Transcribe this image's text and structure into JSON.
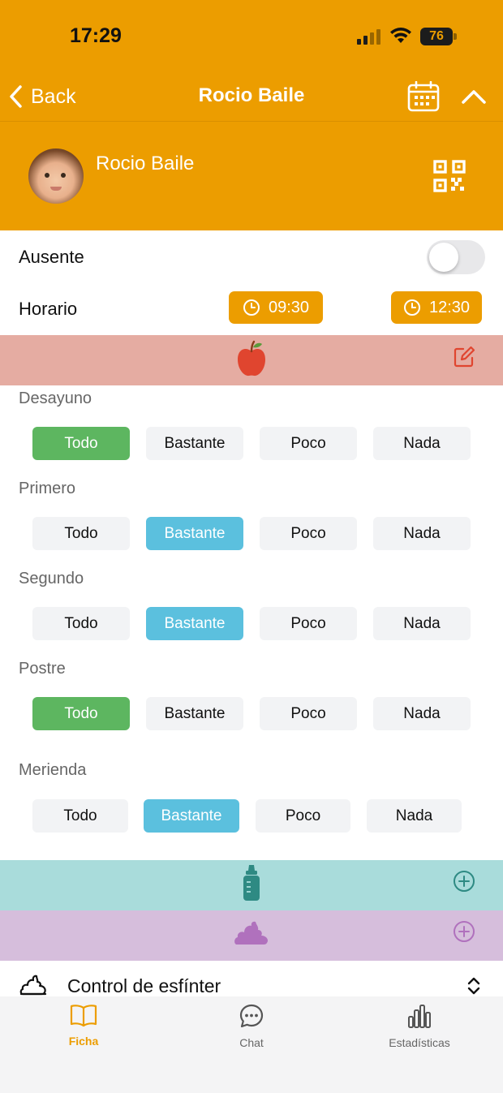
{
  "status_bar": {
    "time": "17:29",
    "battery": "76"
  },
  "nav": {
    "back_label": "Back",
    "title": "Rocio Baile"
  },
  "profile": {
    "name": "Rocio Baile"
  },
  "absence": {
    "label": "Ausente",
    "enabled": false
  },
  "schedule": {
    "label": "Horario",
    "start": "09:30",
    "end": "12:30"
  },
  "colors": {
    "accent": "#ec9d00",
    "selected_all": "#5db660",
    "selected_enough": "#5bc0de",
    "food_band": "#e5aca2",
    "bottle_band": "#a9dcdb",
    "diaper_band": "#d6bedc"
  },
  "icons": {
    "food": "apple-icon",
    "food_edit": "edit-icon",
    "bottle": "baby-bottle-icon",
    "diaper": "poop-icon",
    "add": "add-circle-icon"
  },
  "meals": [
    {
      "name": "Desayuno",
      "options": [
        "Todo",
        "Bastante",
        "Poco",
        "Nada"
      ],
      "selected": "Todo"
    },
    {
      "name": "Primero",
      "options": [
        "Todo",
        "Bastante",
        "Poco",
        "Nada"
      ],
      "selected": "Bastante"
    },
    {
      "name": "Segundo",
      "options": [
        "Todo",
        "Bastante",
        "Poco",
        "Nada"
      ],
      "selected": "Bastante"
    },
    {
      "name": "Postre",
      "options": [
        "Todo",
        "Bastante",
        "Poco",
        "Nada"
      ],
      "selected": "Todo"
    },
    {
      "name": "Merienda",
      "options": [
        "Todo",
        "Bastante",
        "Poco",
        "Nada"
      ],
      "selected": "Bastante"
    }
  ],
  "sphincter": {
    "label": "Control de esfínter"
  },
  "tabs": [
    {
      "label": "Ficha",
      "icon": "book-icon",
      "active": true
    },
    {
      "label": "Chat",
      "icon": "chat-icon",
      "active": false
    },
    {
      "label": "Estadísticas",
      "icon": "bar-chart-icon",
      "active": false
    }
  ]
}
